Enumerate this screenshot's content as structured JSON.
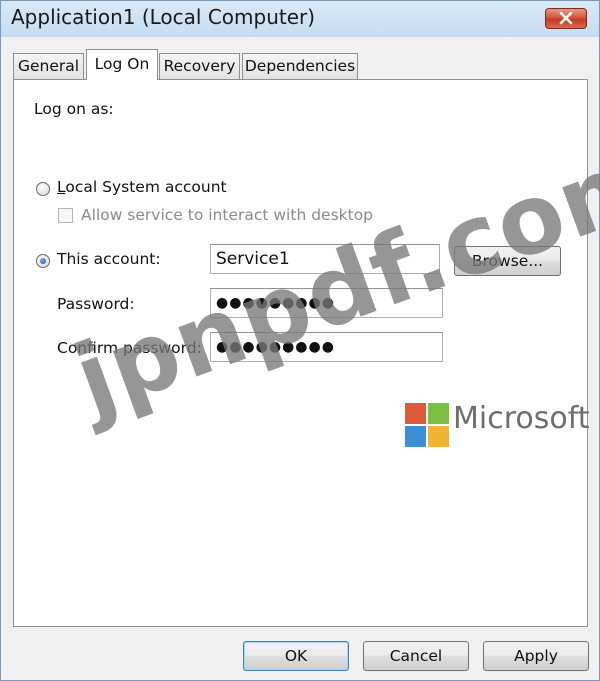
{
  "window": {
    "title": "Application1 (Local Computer)"
  },
  "tabs": [
    {
      "label": "General",
      "active": false
    },
    {
      "label": "Log On",
      "active": true
    },
    {
      "label": "Recovery",
      "active": false
    },
    {
      "label": "Dependencies",
      "active": false
    }
  ],
  "logon": {
    "heading": "Log on as:",
    "local_system": {
      "label": "Local System account",
      "checked": false
    },
    "allow_desktop": {
      "label": "Allow service to interact with desktop",
      "checked": false,
      "enabled": false
    },
    "this_account": {
      "label": "This account:",
      "checked": true,
      "value": "Service1"
    },
    "browse_label": "Browse...",
    "password": {
      "label": "Password:",
      "value": "●●●●●●●●●"
    },
    "confirm_password": {
      "label": "Confirm password:",
      "value": "●●●●●●●●●"
    }
  },
  "buttons": {
    "ok": "OK",
    "cancel": "Cancel",
    "apply": "Apply"
  },
  "watermark": {
    "text": "jpnpdf.com",
    "brand": "Microsoft",
    "logo_colors": [
      "#e05a3a",
      "#7cbf42",
      "#3a8fd6",
      "#f2b233"
    ]
  }
}
